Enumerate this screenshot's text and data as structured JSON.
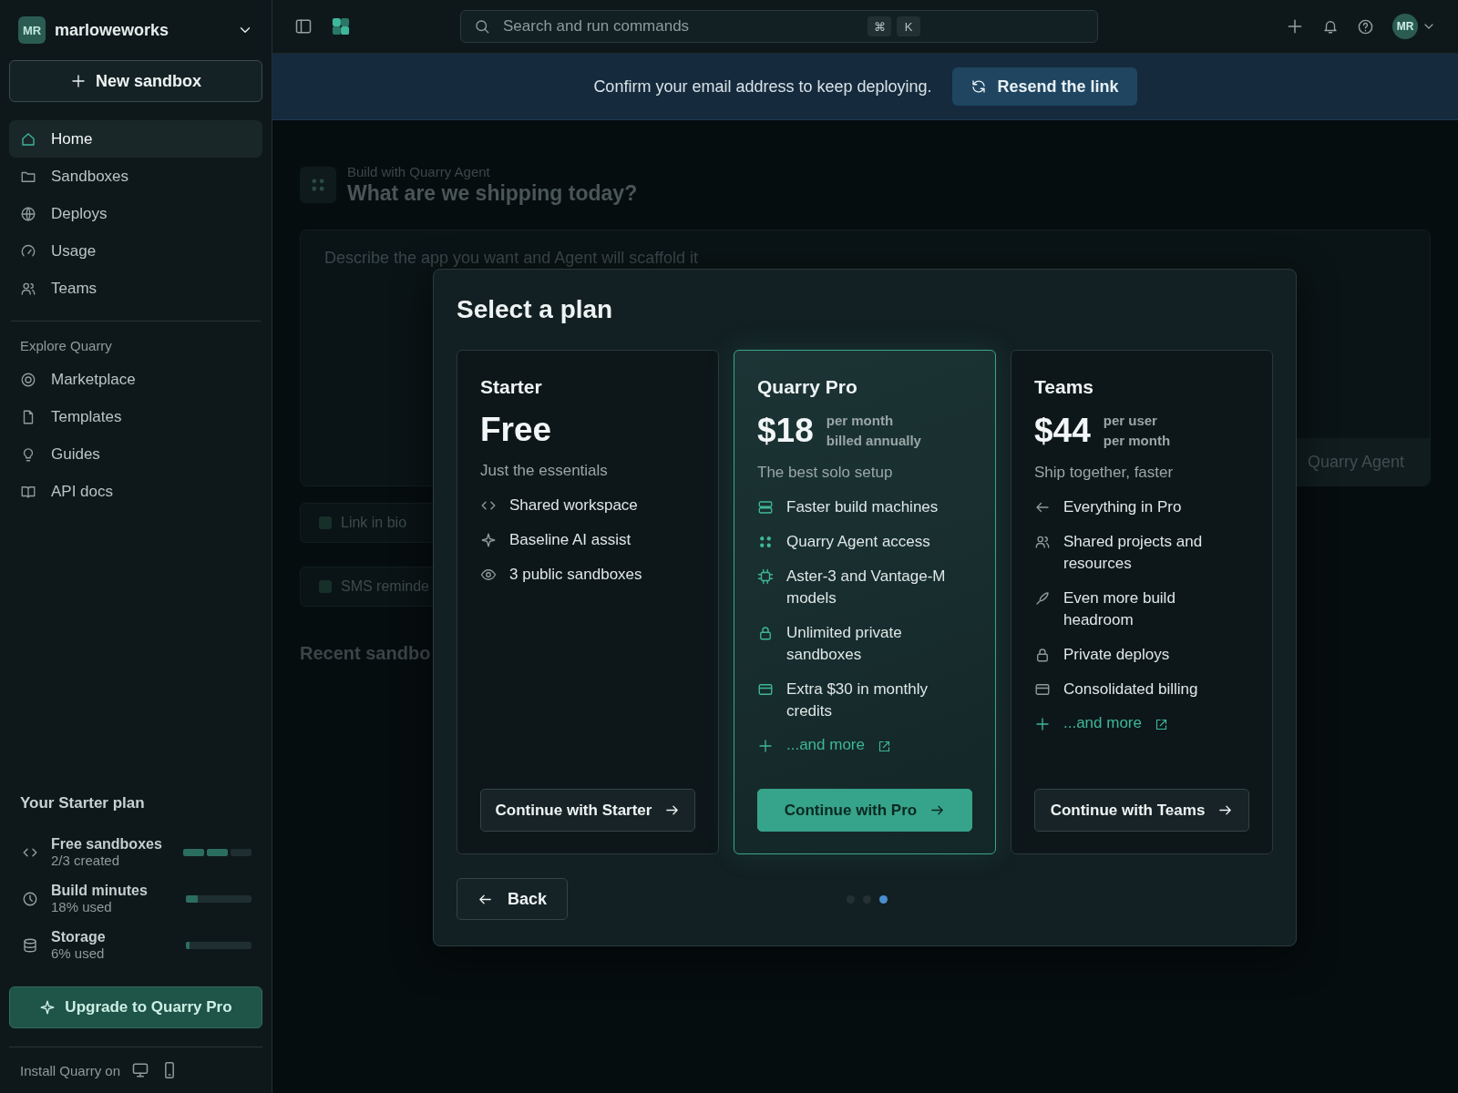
{
  "workspace": {
    "avatar": "MR",
    "name": "marloweworks"
  },
  "new_button": {
    "label": "New sandbox"
  },
  "nav": [
    {
      "label": "Home",
      "selected": true
    },
    {
      "label": "Sandboxes",
      "selected": false
    },
    {
      "label": "Deploys",
      "selected": false
    },
    {
      "label": "Usage",
      "selected": false
    },
    {
      "label": "Teams",
      "selected": false
    }
  ],
  "explore": {
    "heading": "Explore Quarry",
    "items": [
      {
        "label": "Marketplace",
        "selected": false
      },
      {
        "label": "Templates",
        "selected": false
      },
      {
        "label": "Guides",
        "selected": false
      },
      {
        "label": "API docs",
        "selected": false
      }
    ]
  },
  "plan_usage": {
    "heading": "Your Starter plan",
    "meters": [
      {
        "kind": "segmented",
        "name": "Free sandboxes",
        "detail": "2/3 created",
        "level": 0.6667
      },
      {
        "kind": "bar",
        "name": "Build minutes",
        "detail": "18% used",
        "level": 0.18
      },
      {
        "kind": "bar",
        "name": "Storage",
        "detail": "6% used",
        "level": 0.06
      }
    ]
  },
  "upgrade_button": {
    "label": "Upgrade to Quarry Pro"
  },
  "install": {
    "label": "Install Quarry on"
  },
  "topbar": {
    "search": {
      "placeholder": "Search and run commands",
      "shortcut": [
        "⌘",
        "K"
      ]
    },
    "avatar": "MR"
  },
  "banner": {
    "message": "Confirm your email address to keep deploying.",
    "button": "Resend the link"
  },
  "home": {
    "eyebrow": "Build with Quarry Agent",
    "title": "What are we shipping today?",
    "prompt": {
      "placeholder": "Describe the app you want and Agent will scaffold it",
      "button": "Quarry Agent"
    },
    "chips": [
      {
        "label": "Link in bio",
        "checked": false
      },
      {
        "label": "SMS reminde",
        "checked": false
      }
    ],
    "section_title": "Recent sandbo"
  },
  "modal": {
    "title": "Select a plan",
    "plans": [
      {
        "name": "Starter",
        "price": "Free",
        "tagline": "Just the essentials",
        "selected": false,
        "button": "Continue with Starter",
        "features": [
          {
            "kind": "feature",
            "text": "Shared workspace"
          },
          {
            "kind": "feature",
            "text": "Baseline AI assist"
          },
          {
            "kind": "feature",
            "text": "3 public sandboxes"
          }
        ]
      },
      {
        "name": "Quarry Pro",
        "price": "$18",
        "price_note": [
          "per month",
          "billed annually"
        ],
        "tagline": "The best solo setup",
        "selected": true,
        "button": "Continue with Pro",
        "features": [
          {
            "kind": "feature",
            "text": "Faster build machines"
          },
          {
            "kind": "feature",
            "text": "Quarry Agent access"
          },
          {
            "kind": "feature",
            "text": "Aster-3 and Vantage-M models"
          },
          {
            "kind": "feature",
            "text": "Unlimited private sandboxes"
          },
          {
            "kind": "feature",
            "text": "Extra $30 in monthly credits"
          },
          {
            "kind": "link",
            "text": "...and more"
          }
        ]
      },
      {
        "name": "Teams",
        "price": "$44",
        "price_note": [
          "per user",
          "per month"
        ],
        "tagline": "Ship together, faster",
        "selected": false,
        "button": "Continue with Teams",
        "features": [
          {
            "kind": "feature",
            "text": "Everything in Pro"
          },
          {
            "kind": "feature",
            "text": "Shared projects and resources"
          },
          {
            "kind": "feature",
            "text": "Even more build headroom"
          },
          {
            "kind": "feature",
            "text": "Private deploys"
          },
          {
            "kind": "feature",
            "text": "Consolidated billing"
          },
          {
            "kind": "link",
            "text": "...and more"
          }
        ]
      }
    ],
    "back_button": "Back",
    "pages": [
      {
        "selected": false
      },
      {
        "selected": false
      },
      {
        "selected": true
      }
    ]
  }
}
